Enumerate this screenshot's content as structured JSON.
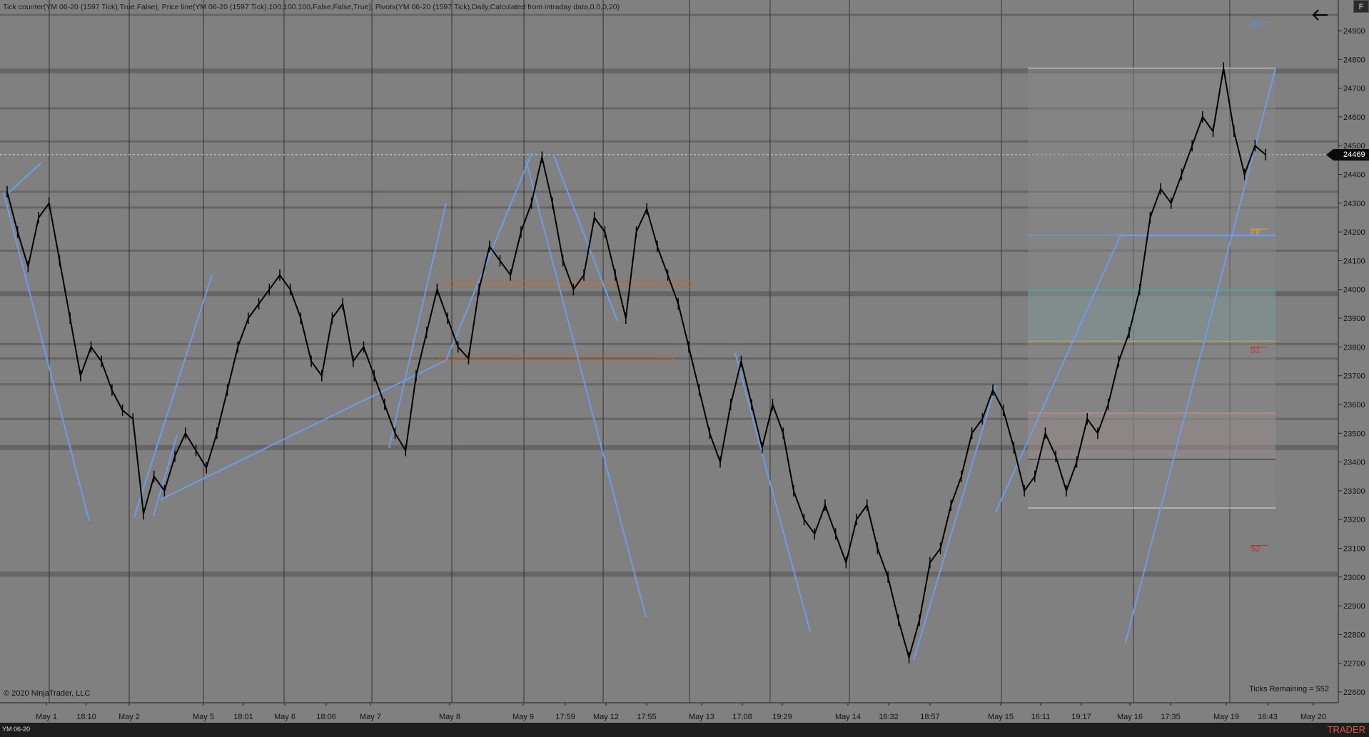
{
  "header": {
    "indicators": "Tick counter(YM 06-20 (1597 Tick),True,False), Price line(YM 06-20 (1597 Tick),100,100,100,False,False,True), Pivots(YM 06-20 (1597 Tick),Daily,Calculated from intraday data,0,0,0,20)"
  },
  "footer": {
    "copyright": "© 2020 NinjaTrader, LLC",
    "ticks_remaining": "Ticks Remaining = 552",
    "instrument": "YM 06-20",
    "brand": "TRADER"
  },
  "controls": {
    "f_button": "F",
    "back_icon": "arrow-left-icon"
  },
  "colors": {
    "background": "#808080",
    "trendline": "#6f9be8",
    "price": "#000000",
    "pivot_r1": "#5b8fe0",
    "pivot_pp": "#d9a23a",
    "pivot_s1": "#c03030",
    "pivot_s2": "#c03030"
  },
  "current_price": "24469",
  "y_axis": {
    "ticks": [
      "24900",
      "24800",
      "24700",
      "24600",
      "24500",
      "24400",
      "24300",
      "24200",
      "24100",
      "24000",
      "23900",
      "23800",
      "23700",
      "23600",
      "23500",
      "23400",
      "23300",
      "23200",
      "23100",
      "23000",
      "22900",
      "22800",
      "22700",
      "22600"
    ]
  },
  "x_axis": {
    "labels": [
      "May 1",
      "18:10",
      "May 2",
      "May 5",
      "18:01",
      "May 6",
      "18:06",
      "May 7",
      "May 8",
      "May 9",
      "17:59",
      "May 12",
      "17:55",
      "May 13",
      "17:08",
      "19:29",
      "May 14",
      "16:32",
      "18:57",
      "May 15",
      "16:11",
      "19:17",
      "May 16",
      "17:35",
      "May 19",
      "16:43",
      "May 20"
    ]
  },
  "pivots": [
    {
      "label": "R1",
      "value": 24920
    },
    {
      "label": "PP",
      "value": 24200
    },
    {
      "label": "S1",
      "value": 23790
    },
    {
      "label": "S2",
      "value": 23100
    }
  ],
  "chart_data": {
    "type": "line",
    "series": [
      {
        "x": [
          0,
          1,
          2,
          3,
          4,
          5,
          6,
          7,
          8,
          9,
          10,
          11,
          12,
          13,
          14,
          15,
          16,
          17,
          18,
          19,
          20,
          21,
          22,
          23,
          24,
          25,
          26,
          27,
          28,
          29,
          30,
          31,
          32,
          33,
          34,
          35,
          36,
          37,
          38,
          39,
          40,
          41,
          42,
          43,
          44,
          45,
          46,
          47,
          48,
          49,
          50,
          51,
          52,
          53,
          54,
          55,
          56,
          57,
          58,
          59,
          60,
          61,
          62,
          63,
          64,
          65,
          66,
          67,
          68,
          69,
          70,
          71,
          72,
          73,
          74,
          75,
          76,
          77,
          78,
          79,
          80,
          81,
          82,
          83,
          84,
          85,
          86,
          87,
          88,
          89,
          90,
          91,
          92,
          93,
          94,
          95,
          96,
          97,
          98,
          99,
          100,
          101,
          102,
          103,
          104,
          105,
          106,
          107,
          108,
          109,
          110,
          111,
          112,
          113,
          114,
          115,
          116,
          117,
          118,
          119,
          120
        ],
        "values": [
          24340,
          24200,
          24080,
          24250,
          24300,
          24100,
          23900,
          23700,
          23800,
          23750,
          23650,
          23580,
          23550,
          23220,
          23350,
          23300,
          23420,
          23500,
          23440,
          23380,
          23500,
          23650,
          23800,
          23900,
          23950,
          24000,
          24050,
          24000,
          23900,
          23750,
          23700,
          23900,
          23950,
          23750,
          23800,
          23700,
          23600,
          23500,
          23440,
          23700,
          23850,
          24000,
          23900,
          23800,
          23760,
          24000,
          24150,
          24100,
          24050,
          24200,
          24300,
          24460,
          24300,
          24100,
          24000,
          24050,
          24250,
          24200,
          24050,
          23900,
          24200,
          24280,
          24150,
          24050,
          23950,
          23800,
          23650,
          23500,
          23400,
          23600,
          23750,
          23600,
          23450,
          23600,
          23500,
          23300,
          23200,
          23150,
          23250,
          23150,
          23050,
          23200,
          23250,
          23100,
          23000,
          22850,
          22720,
          22850,
          23050,
          23100,
          23250,
          23350,
          23500,
          23550,
          23650,
          23580,
          23450,
          23300,
          23350,
          23500,
          23420,
          23300,
          23400,
          23550,
          23500,
          23600,
          23750,
          23850,
          24000,
          24250,
          24350,
          24300,
          24400,
          24500,
          24600,
          24550,
          24770,
          24550,
          24400,
          24500,
          24469
        ]
      }
    ],
    "ylim": [
      22560,
      24960
    ],
    "xlabel": "",
    "ylabel": "",
    "grid": true
  }
}
